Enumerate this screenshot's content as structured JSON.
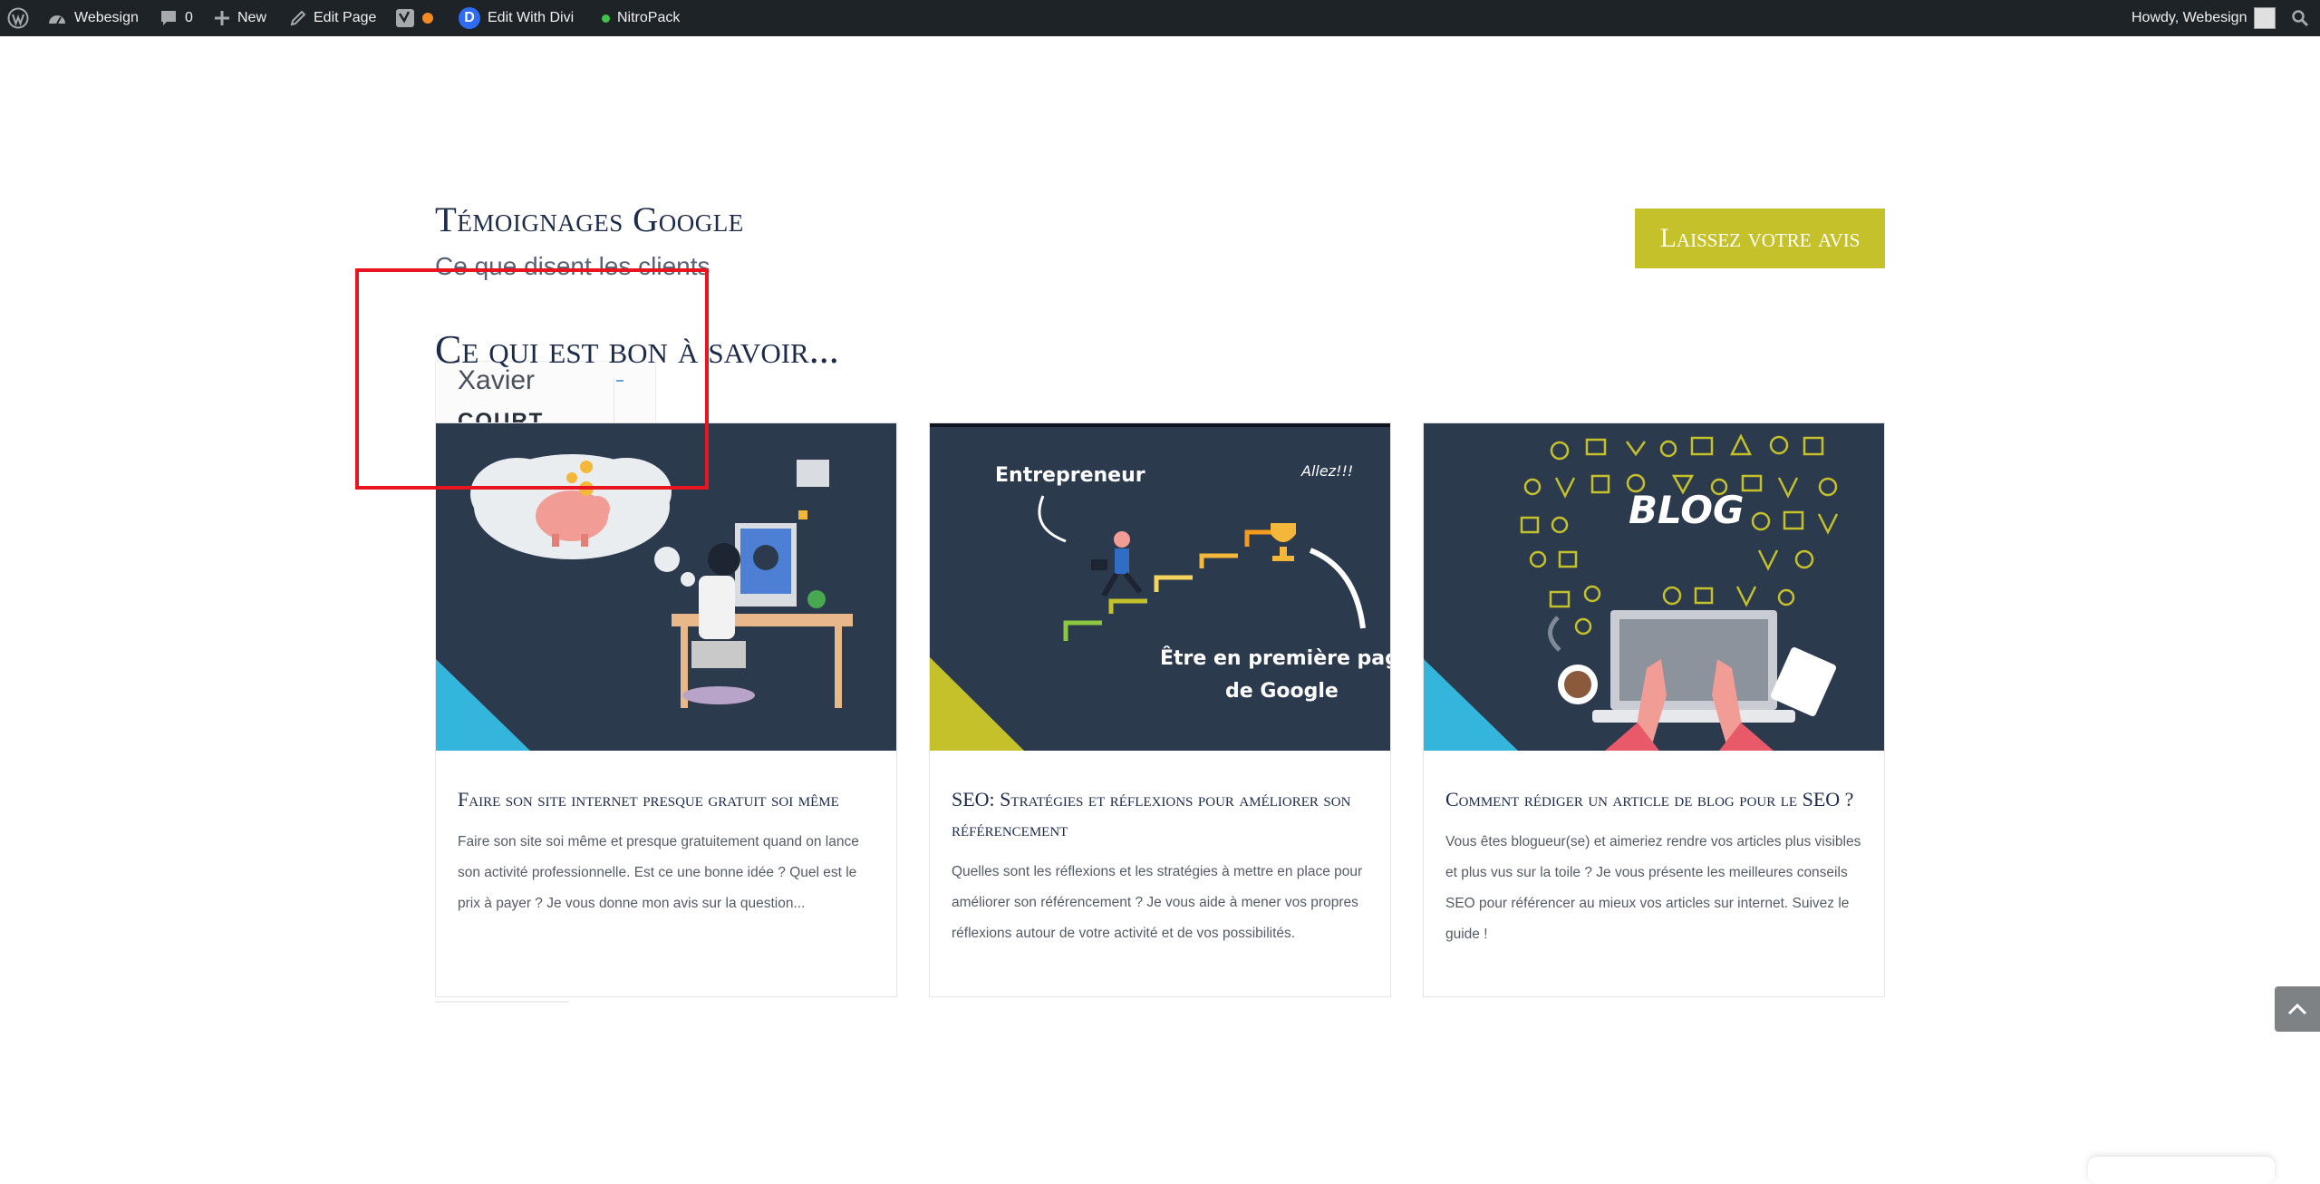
{
  "adminbar": {
    "site_name": "Webesign",
    "comments_count": "0",
    "new_label": "New",
    "edit_page_label": "Edit Page",
    "edit_divi_label": "Edit With Divi",
    "divi_letter": "D",
    "nitropack_label": "NitroPack",
    "howdy_label": "Howdy, Webesign"
  },
  "testimonials": {
    "title": "Témoignages Google",
    "subtitle": "Ce que disent les clients",
    "cta_label": "Laissez votre avis",
    "fragment_name": "Xavier",
    "fragment_name2": "COURT"
  },
  "blog": {
    "title": "Ce qui est bon à savoir...",
    "cards": [
      {
        "title": "Faire son site internet presque gratuit soi même",
        "excerpt": "Faire son site soi même et presque gratuitement quand on lance son activité professionnelle. Est ce une bonne idée ? Quel est le prix à payer ? Je vous donne mon avis sur la question..."
      },
      {
        "title": "SEO: Stratégies et réflexions pour améliorer son référencement",
        "excerpt": "Quelles sont les réflexions et les stratégies à mettre en place pour améliorer son référencement ? Je vous aide à mener vos propres réflexions autour de votre activité et de vos possibilités.",
        "img_text_1": "Entrepreneur",
        "img_text_2": "Allez!!!",
        "img_text_3": "Être en première page",
        "img_text_4": "de Google"
      },
      {
        "title": "Comment rédiger un article de blog pour le SEO ?",
        "excerpt": "Vous êtes blogueur(se) et aimeriez rendre vos articles plus visibles et plus vus sur la toile ? Je vous présente les meilleures conseils SEO pour référencer au mieux vos articles sur internet. Suivez le guide !",
        "img_text_1": "BLOG"
      }
    ]
  },
  "colors": {
    "admin_bg": "#1d2327",
    "accent": "#c5c12b",
    "navy": "#1c2b4a",
    "image_bg": "#2c3a4e",
    "cyan": "#33b5dc",
    "highlight": "#e8141e"
  }
}
